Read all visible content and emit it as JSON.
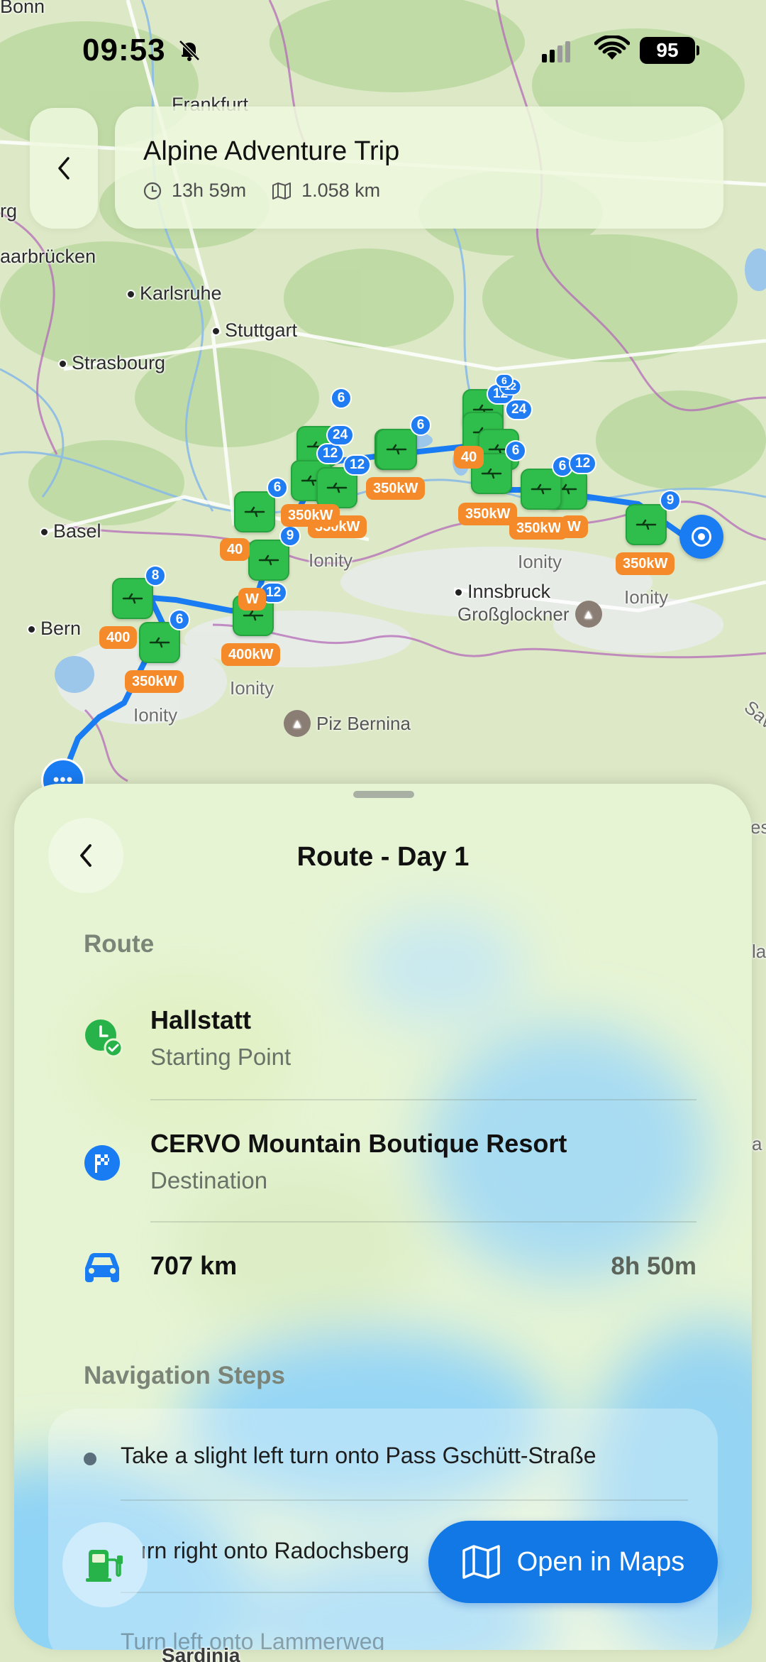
{
  "status_bar": {
    "time": "09:53",
    "battery": "95"
  },
  "header": {
    "title": "Alpine Adventure Trip",
    "duration": "13h 59m",
    "distance": "1.058 km"
  },
  "map": {
    "labels": {
      "bonn": "Bonn",
      "frankfurt": "Frankfurt",
      "saarbrucken": "aarbrücken",
      "karlsruhe": "Karlsruhe",
      "stuttgart": "Stuttgart",
      "strasbourg": "Strasbourg",
      "basel": "Basel",
      "bern": "Bern",
      "innsbruck": "Innsbruck",
      "grossglockner": "Großglockner",
      "piz_bernina": "Piz Bernina",
      "ionity": "Ionity",
      "edge_rg": "rg",
      "edge_es": "es",
      "edge_la": "la",
      "edge_a": "a",
      "edge_sava": "Sava",
      "sardinia": "Sardinia"
    },
    "counts": {
      "c1": "6",
      "c2": "12",
      "c3": "24",
      "c4": "6",
      "c5": "12",
      "c6": "24",
      "c7": "12",
      "c8": "6",
      "c9": "6",
      "c10": "6",
      "c11": "12",
      "c12": "9",
      "c13": "9",
      "c14": "12",
      "c15": "8",
      "c16": "6",
      "c17": "12",
      "c18": "6"
    },
    "power": {
      "p350": "350kW",
      "p400": "400kW",
      "p400short": "400",
      "p40": "40",
      "pW": "W"
    }
  },
  "sheet": {
    "title": "Route - Day 1",
    "route_label": "Route",
    "start_name": "Hallstatt",
    "start_sub": "Starting Point",
    "dest_name": "CERVO Mountain Boutique Resort",
    "dest_sub": "Destination",
    "distance": "707 km",
    "duration": "8h 50m",
    "nav_label": "Navigation Steps",
    "steps": [
      "Take a slight left turn onto Pass Gschütt-Straße",
      "ırn right onto Radochsberg",
      "Turn left onto Lammerweg"
    ],
    "open_maps": "Open in Maps"
  },
  "colors": {
    "accent": "#1278e6",
    "charger": "#2fbd4b",
    "power_badge": "#f58a2a",
    "route": "#1a7cf2"
  }
}
